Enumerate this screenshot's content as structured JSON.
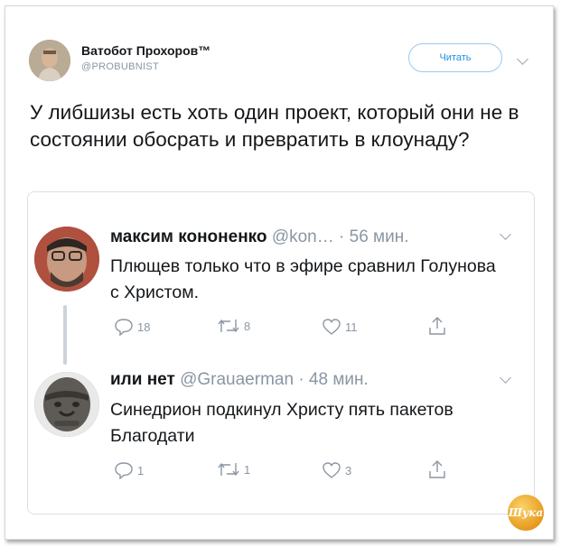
{
  "tweet": {
    "author_name": "Ватобот Прохоров™",
    "author_handle": "@PROBUBNIST",
    "follow_label": "Читать",
    "text": "У либшизы есть хоть один проект, который они не в состоянии обосрать и превратить в клоунаду?"
  },
  "quoted": [
    {
      "name": "максим кононенко",
      "meta": " @kon… · 56 мин.",
      "text": "Плющев только что в эфире сравнил Голунова с Христом.",
      "replies": "18",
      "retweets": "8",
      "likes": "11"
    },
    {
      "name": "или нет",
      "meta": " @Grauaerman · 48 мин.",
      "text": "Синедрион подкинул Христу пять пакетов Благодати",
      "replies": "1",
      "retweets": "1",
      "likes": "3"
    }
  ],
  "watermark": "Шука",
  "icons": [
    "reply-icon",
    "retweet-icon",
    "like-icon",
    "share-icon",
    "chevron-down-icon"
  ],
  "colors": {
    "accent": "#1d8fe0",
    "muted": "#8a96a3",
    "text": "#14171a"
  }
}
